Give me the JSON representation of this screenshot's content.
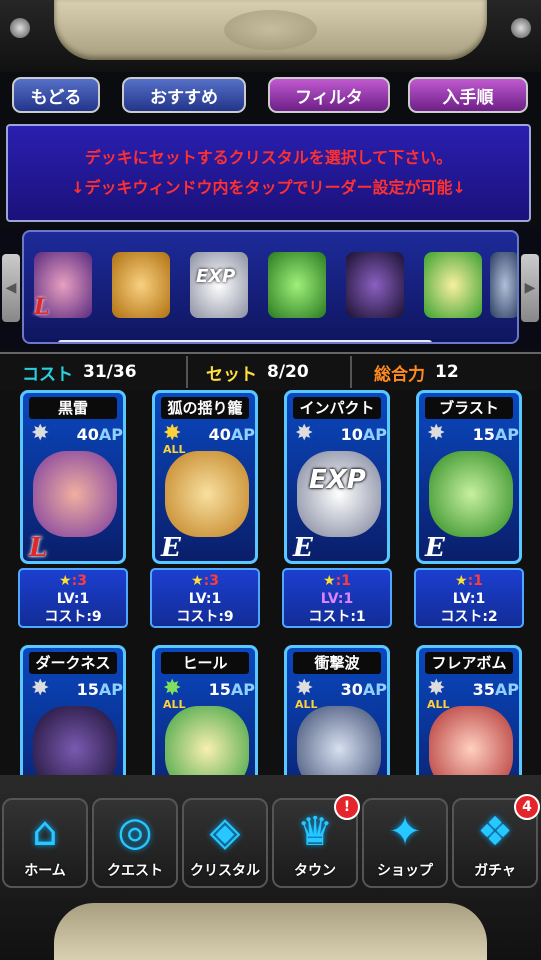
{
  "header": {
    "back_label": "もどる",
    "recommend_label": "おすすめ",
    "filter_label": "フィルタ",
    "order_label": "入手順"
  },
  "message": {
    "line1": "デッキにセットするクリスタルを選択して下さい。",
    "line2": "↓デッキウィンドウ内をタップでリーダー設定が可能↓"
  },
  "deck": {
    "icons": [
      "dark-knight-leader-icon",
      "fox-girl-icon",
      "exp-crystal-icon",
      "green-fairy-icon",
      "dark-crystal-icon",
      "yellow-fairy-icon",
      "dragon-icon"
    ],
    "leader_mark": "L",
    "exp_text": "EXP"
  },
  "stats": {
    "cost_label": "コスト",
    "cost_value": "31/36",
    "set_label": "セット",
    "set_value": "8/20",
    "power_label": "総合力",
    "power_value": "12",
    "colors": {
      "cost": "#29d0e0",
      "set": "#ffe040",
      "power": "#ff8a20"
    }
  },
  "cards": [
    {
      "name": "黒雷",
      "ap": "40",
      "ap_unit": "AP",
      "all": "",
      "rank": "L",
      "stars": "3",
      "lv": "LV:1",
      "cost": "コスト:9",
      "art_color": "#b06ad0"
    },
    {
      "name": "狐の揺り籠",
      "ap": "40",
      "ap_unit": "AP",
      "all": "ALL",
      "rank": "E",
      "stars": "3",
      "lv": "LV:1",
      "cost": "コスト:9",
      "art_color": "#f0b040"
    },
    {
      "name": "インパクト",
      "ap": "10",
      "ap_unit": "AP",
      "all": "",
      "rank": "E",
      "stars": "1",
      "lv": "LV:1",
      "cost": "コスト:1",
      "art_color": "#d0d8e8",
      "exp": "EXP"
    },
    {
      "name": "ブラスト",
      "ap": "15",
      "ap_unit": "AP",
      "all": "",
      "rank": "E",
      "stars": "1",
      "lv": "LV:1",
      "cost": "コスト:2",
      "art_color": "#5cc850"
    },
    {
      "name": "ダークネス",
      "ap": "15",
      "ap_unit": "AP",
      "all": "",
      "rank": "",
      "art_color": "#3a2a60"
    },
    {
      "name": "ヒール",
      "ap": "15",
      "ap_unit": "AP",
      "all": "ALL",
      "rank": "",
      "art_color": "#9ee07a"
    },
    {
      "name": "衝撃波",
      "ap": "30",
      "ap_unit": "AP",
      "all": "ALL",
      "rank": "",
      "art_color": "#8aa0c0"
    },
    {
      "name": "フレアボム",
      "ap": "35",
      "ap_unit": "AP",
      "all": "ALL",
      "rank": "",
      "art_color": "#f07070"
    }
  ],
  "info_star": "★",
  "nav": {
    "home": "ホーム",
    "quest": "クエスト",
    "crystal": "クリスタル",
    "town": "タウン",
    "shop": "ショップ",
    "gacha": "ガチャ",
    "town_badge": "!",
    "gacha_badge": "4"
  }
}
